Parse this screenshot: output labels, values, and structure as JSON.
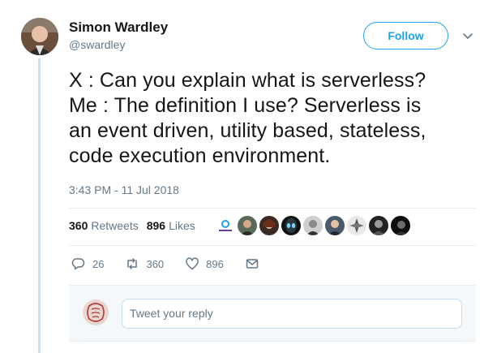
{
  "author": {
    "name": "Simon Wardley",
    "handle": "@swardley"
  },
  "follow_label": "Follow",
  "tweet": {
    "lines": [
      "X : Can you explain what is serverless?",
      "Me : The definition I use? Serverless is",
      "an event driven, utility based, stateless,",
      "code execution environment."
    ],
    "timestamp": "3:43 PM - 11 Jul 2018"
  },
  "stats": {
    "retweets_count": "360",
    "retweets_label": "Retweets",
    "likes_count": "896",
    "likes_label": "Likes"
  },
  "liker_avatars": [
    "pyoneer-logo",
    "person",
    "person",
    "alien",
    "person",
    "person",
    "person",
    "person",
    "person"
  ],
  "actions": {
    "replies": "26",
    "retweets": "360",
    "likes": "896"
  },
  "reply": {
    "placeholder": "Tweet your reply"
  },
  "colors": {
    "accent": "#1da1f2",
    "thread_line": "#c4e4f8",
    "muted": "#657786"
  }
}
